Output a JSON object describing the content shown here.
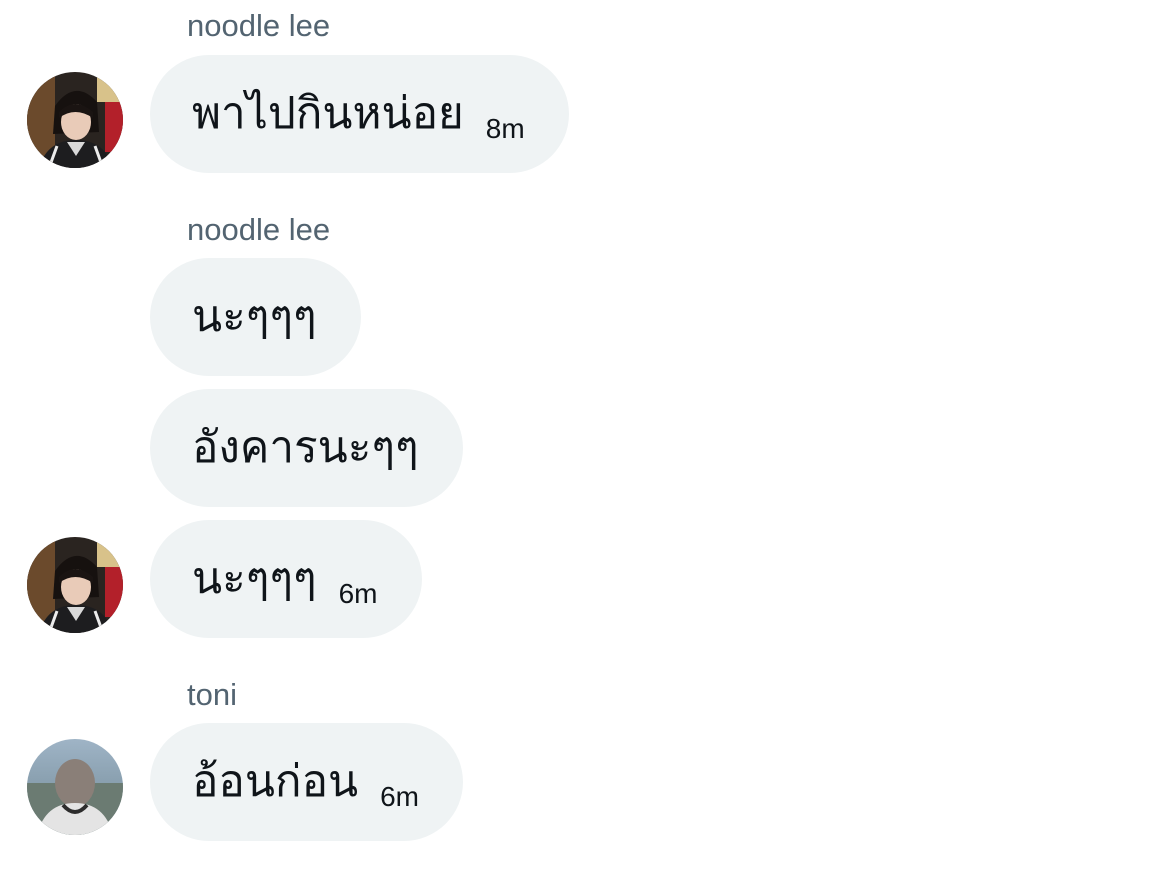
{
  "messages": [
    {
      "sender": "noodle lee",
      "text": "พาไปกินหน่อย",
      "time": "8m"
    },
    {
      "sender": "noodle lee",
      "text": "นะๆๆๆ"
    },
    {
      "text": "อังคารนะๆๆ"
    },
    {
      "text": "นะๆๆๆ",
      "time": "6m"
    },
    {
      "sender": "toni",
      "text": "อ้อนก่อน",
      "time": "6m"
    }
  ],
  "avatars": [
    {
      "user": "noodle lee",
      "icon": "profile-photo"
    },
    {
      "user": "noodle lee",
      "icon": "profile-photo"
    },
    {
      "user": "toni",
      "icon": "profile-photo"
    }
  ],
  "colors": {
    "bubble": "#eff3f4",
    "sender_name": "#536471",
    "text": "#0f1419",
    "background": "#ffffff"
  }
}
